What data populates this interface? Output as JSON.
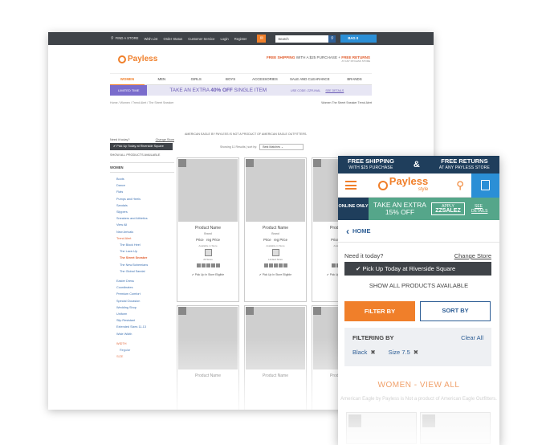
{
  "desktop": {
    "topbar": {
      "find_store": "FIND A STORE",
      "wish_list": "Wish List",
      "order_status": "Order Status",
      "customer_service": "Customer Service",
      "login": "Login",
      "register": "Register",
      "search_placeholder": "Search",
      "bag_label": "BAG",
      "bag_count": "0"
    },
    "logo": "Payless",
    "shipping": {
      "free_shipping": "FREE SHIPPING",
      "with_purchase": " WITH A $25 PURCHASE + ",
      "free_returns": "FREE RETURNS",
      "sub": "AT ANY PAYLESS STORE"
    },
    "nav": [
      "WOMEN",
      "MEN",
      "GIRLS",
      "BOYS",
      "ACCESSORIES",
      "SALE AND CLEARANCE",
      "BRANDS"
    ],
    "promo": {
      "limited": "LIMITED TIME",
      "text_pre": "TAKE AN EXTRA ",
      "text_bold": "40% OFF",
      "text_post": " SINGLE ITEM",
      "code": "USE CODE: ZZFLINAL",
      "details": "SEE DETAILS"
    },
    "breadcrumb": "Home / Women / Trend Alert / The Street Sneaker",
    "breadcrumb_right": "Women The Street Sneaker Trend Alert",
    "disclaimer": "AMERICAN EAGLE BY PAYLESS IS NOT A PRODUCT OF AMERICAN EAGLE OUTFITTERS.",
    "results": "Showing 11 Results | sort by:",
    "sort_value": "Best Matches",
    "sidebar": {
      "need_it": "Need it today?",
      "change_store": "Change Store",
      "pickup": "✔ Pick Up Today at Riverside Square",
      "show_all": "SHOW ALL PRODUCTS AVAILABLE",
      "header": "WOMEN",
      "items": [
        "Boots",
        "Dance",
        "Flats",
        "Pumps and Heels",
        "Sandals",
        "Slippers",
        "Sneakers and Athletics",
        "View All",
        "New Arrivals"
      ],
      "trend_alert": "Trend Alert",
      "trend_items": [
        "The Block Heel",
        "The Lace-Up"
      ],
      "trend_active": "The Street Sneaker",
      "trend_items_after": [
        "The New Bohemians",
        "The Global Sandal"
      ],
      "more_items": [
        "Easter Dress",
        "Coordinates",
        "Premium Comfort",
        "Special Occasion",
        "Wedding Shop",
        "Uniform",
        "Slip Resistant",
        "Extended Sizes 11-13",
        "Wide Width"
      ],
      "width_header": "WIDTH",
      "width_item": "Regular",
      "size_header": "SIZE"
    },
    "product_card": {
      "name": "Product Name",
      "brand": "Brand",
      "price": "Price",
      "reg_price": "reg Price",
      "available": "Available in Store",
      "swatch_label_a": "All Sizes",
      "swatch_label_b": "Limited Sizes",
      "pickup": "✔ Pick Up In Store Eligible"
    }
  },
  "mobile": {
    "ship_left_big": "FREE SHIPPING",
    "ship_left_small": "WITH $25 PURCHASE",
    "ampersand": "&",
    "ship_right_big": "FREE RETURNS",
    "ship_right_small": "AT ANY PAYLESS STORE",
    "logo": "Payless",
    "logo_sub": "style",
    "promo": {
      "online": "ONLINE ONLY",
      "text1": "TAKE AN EXTRA",
      "text2": "15% OFF",
      "apply": "APPLY",
      "code": "ZZSALEZ",
      "details": "SEE DETAILS"
    },
    "home": "HOME",
    "need_it": "Need it today?",
    "change_store": "Change Store",
    "pickup": "✔ Pick Up Today at Riverside Square",
    "show_all": "SHOW ALL PRODUCTS AVAILABLE",
    "filter_by": "FILTER BY",
    "sort_by": "SORT BY",
    "filtering_by": "FILTERING BY",
    "clear_all": "Clear All",
    "tag1": "Black",
    "tag2": "Size 7.5",
    "women_view_all": "WOMEN - VIEW ALL",
    "disclaimer": "American Eagle by Payless is Not a product of American Eagle Outfitters."
  }
}
